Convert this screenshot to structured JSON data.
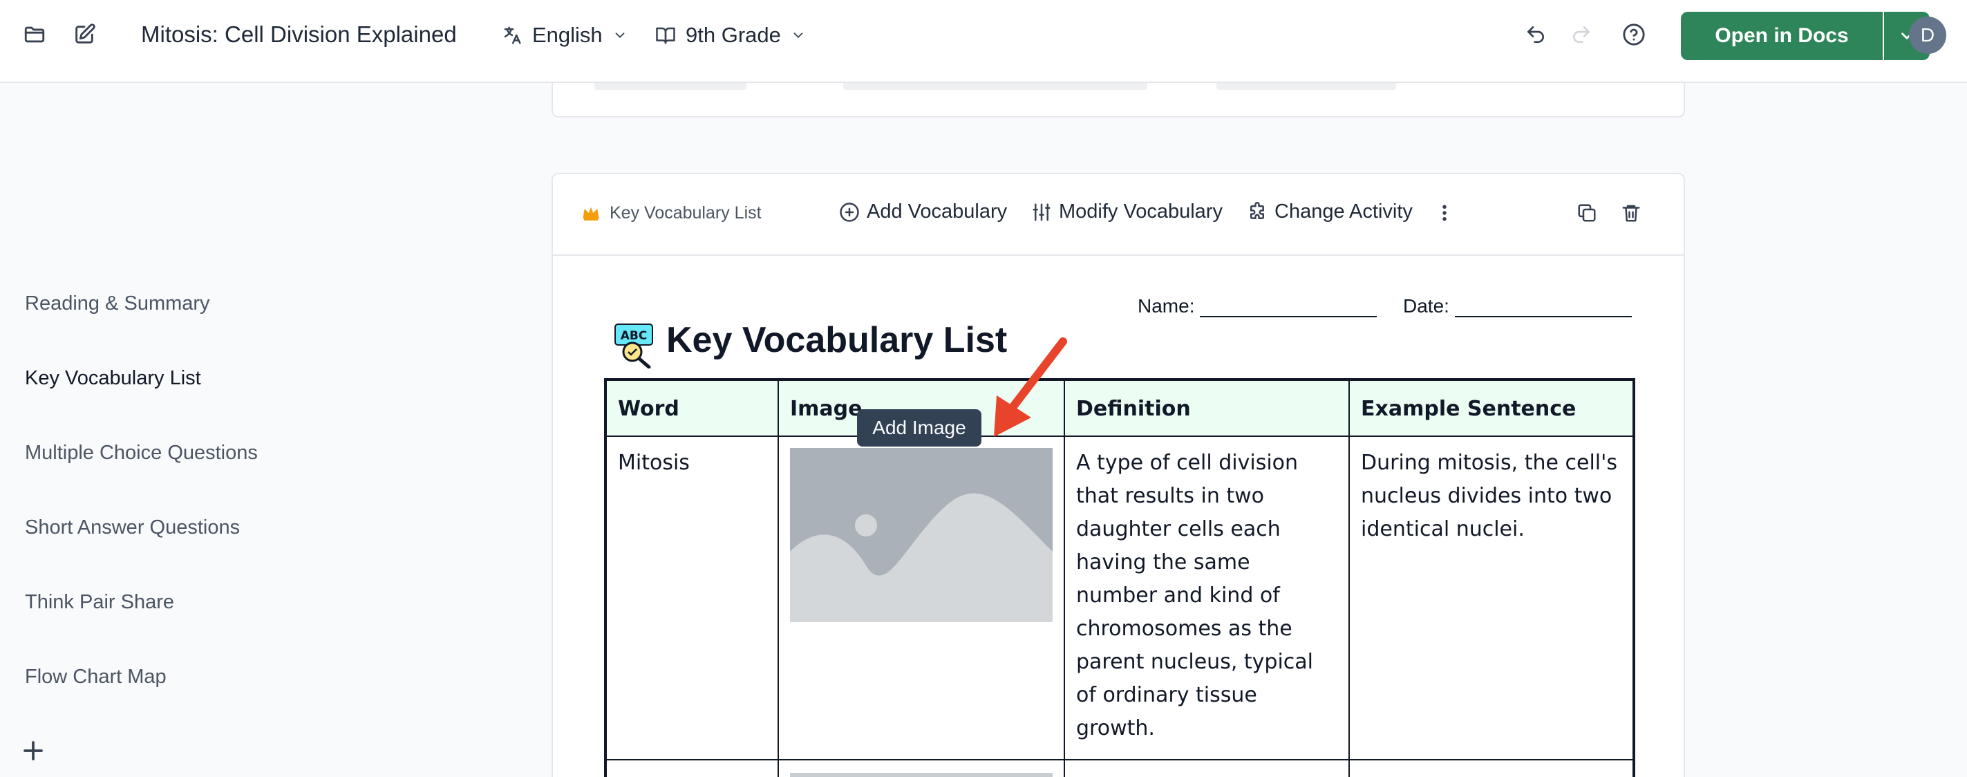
{
  "header": {
    "title": "Mitosis: Cell Division Explained",
    "language": "English",
    "grade": "9th Grade",
    "open_docs_label": "Open in Docs",
    "avatar_initial": "D"
  },
  "sidebar": {
    "items": [
      {
        "label": "Reading & Summary"
      },
      {
        "label": "Key Vocabulary List"
      },
      {
        "label": "Multiple Choice Questions"
      },
      {
        "label": "Short Answer Questions"
      },
      {
        "label": "Think Pair Share"
      },
      {
        "label": "Flow Chart Map"
      }
    ],
    "active": "Key Vocabulary List"
  },
  "card": {
    "label": "Key Vocabulary List",
    "actions": {
      "add": "Add Vocabulary",
      "modify": "Modify Vocabulary",
      "change": "Change Activity"
    }
  },
  "worksheet": {
    "name_label": "Name:",
    "date_label": "Date:",
    "title": "Key Vocabulary List",
    "columns": [
      "Word",
      "Image",
      "Definition",
      "Example Sentence"
    ],
    "rows": [
      {
        "word": "Mitosis",
        "definition": "A type of cell division that results in two daughter cells each having the same number and kind of chromosomes as the parent nucleus, typical of ordinary tissue growth.",
        "example": "During mitosis, the cell's nucleus divides into two identical nuclei."
      }
    ]
  },
  "tooltip": {
    "label": "Add Image"
  },
  "colors": {
    "primary_button": "#2f855a",
    "tooltip_bg": "#334155",
    "annotation_arrow": "#e8432b",
    "table_header_bg": "#ecfdf3"
  }
}
